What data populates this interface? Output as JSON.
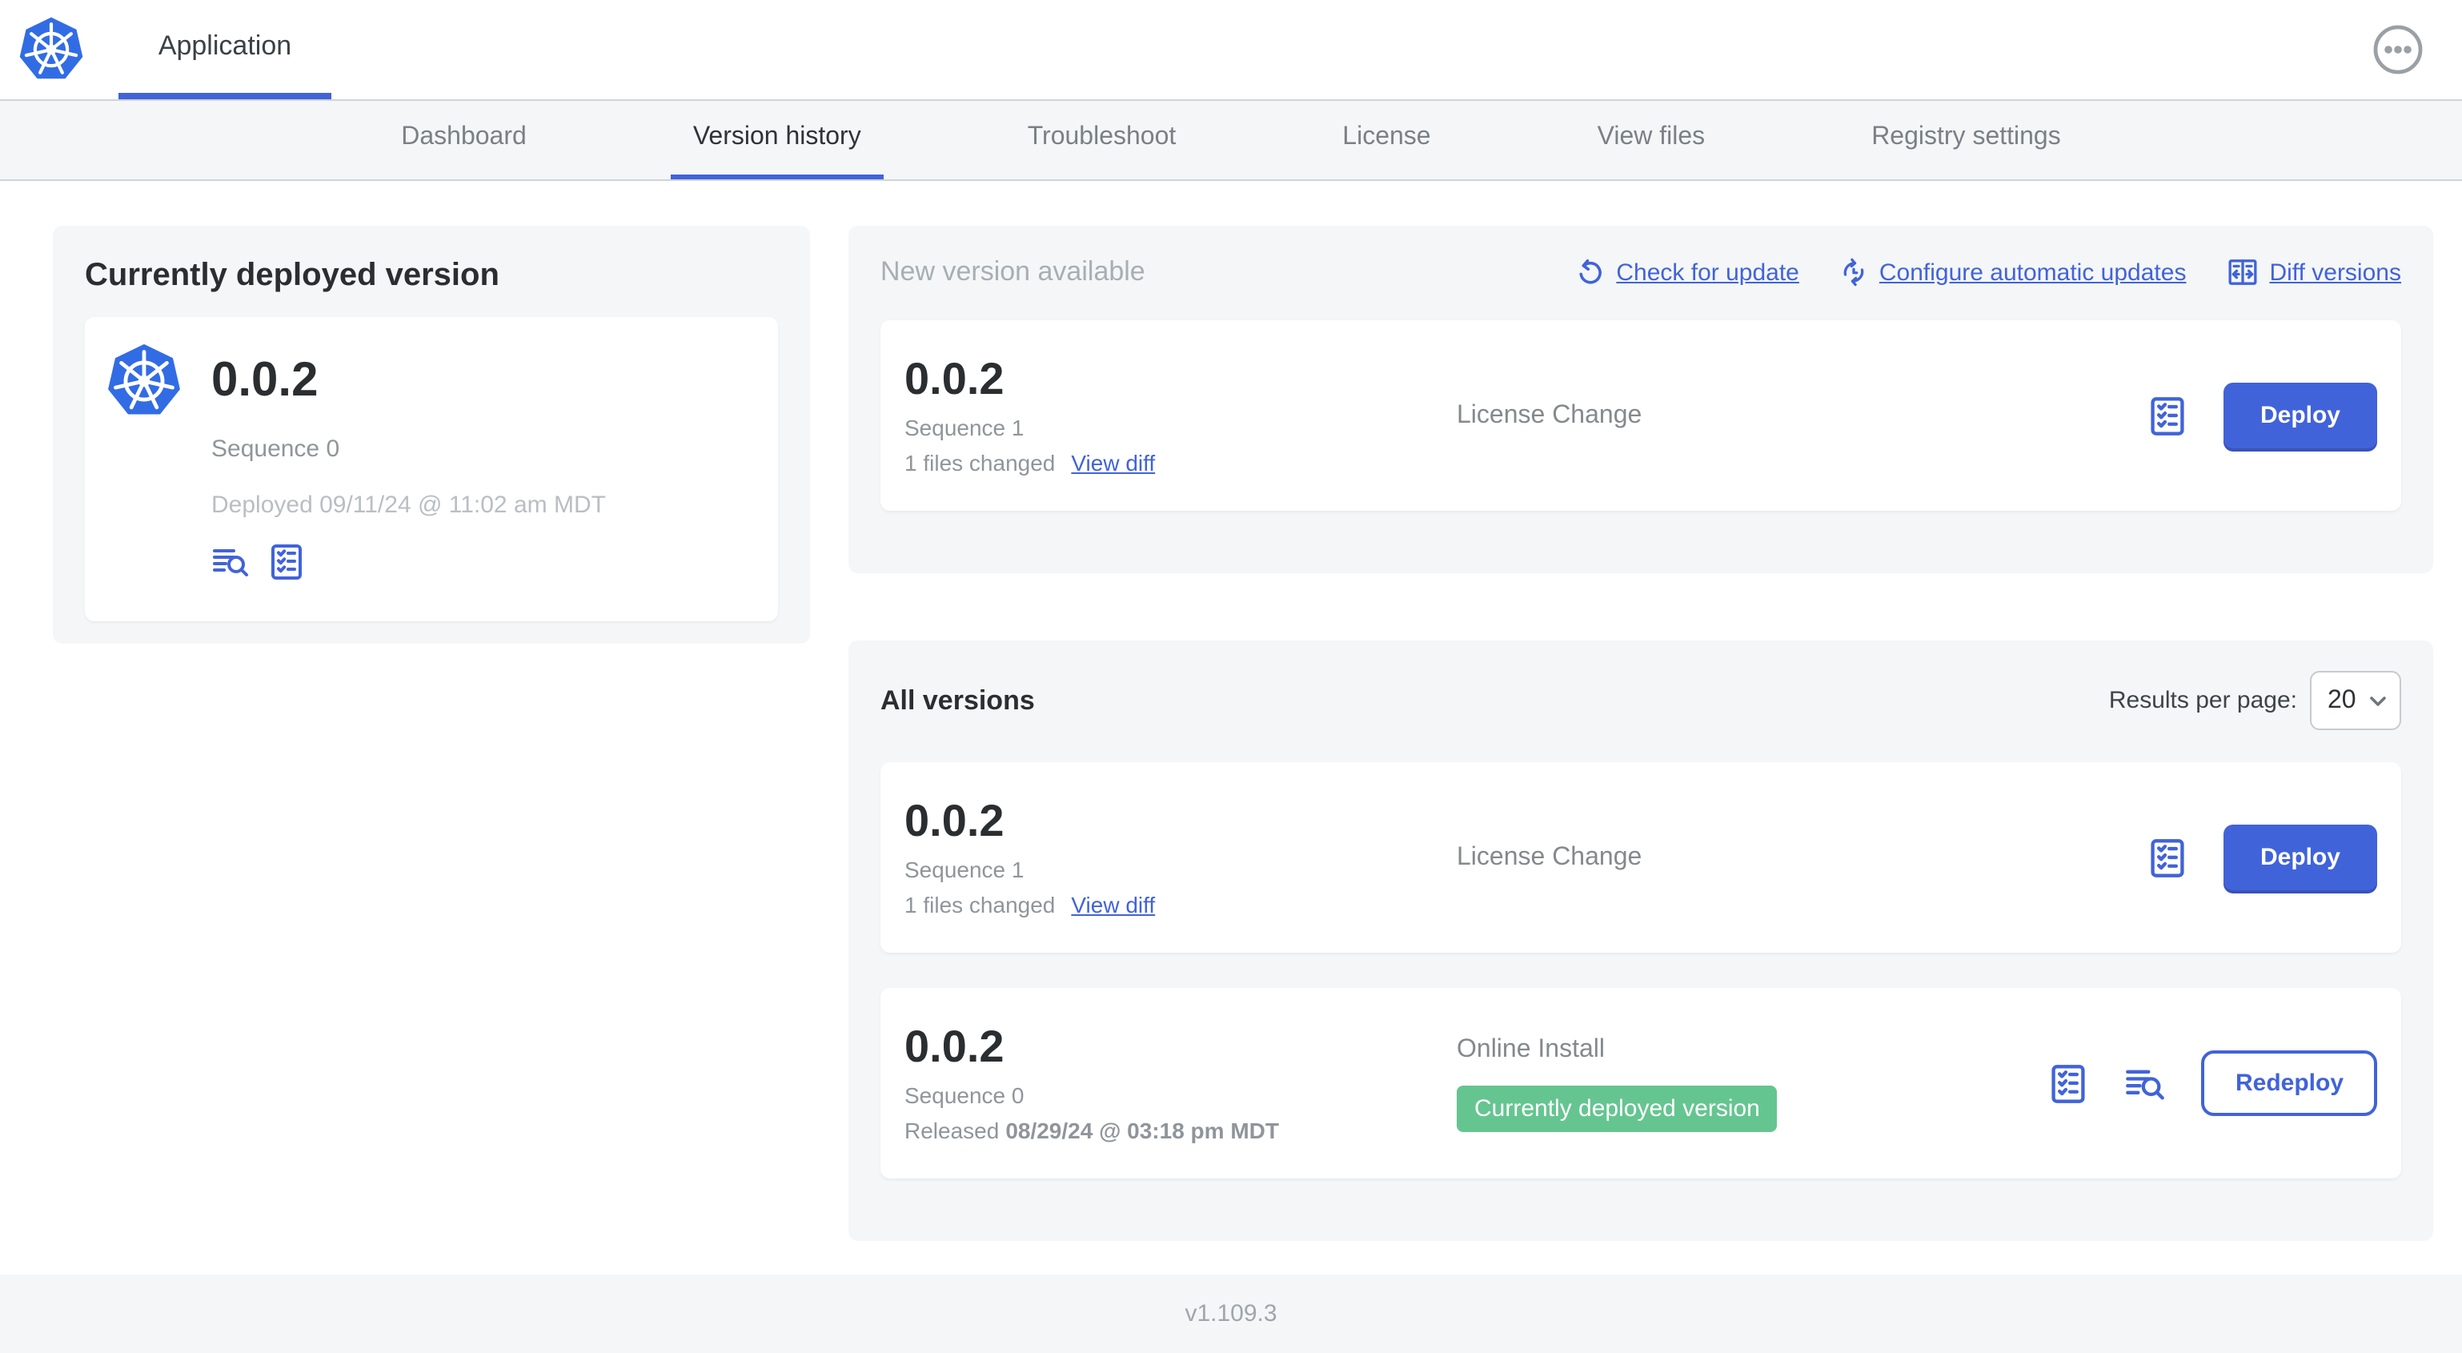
{
  "colors": {
    "accent": "#4163d9",
    "k8s_blue": "#326ce5",
    "green": "#65c590"
  },
  "header": {
    "app_tab": "Application"
  },
  "nav": {
    "tabs": [
      {
        "label": "Dashboard"
      },
      {
        "label": "Version history"
      },
      {
        "label": "Troubleshoot"
      },
      {
        "label": "License"
      },
      {
        "label": "View files"
      },
      {
        "label": "Registry settings"
      }
    ]
  },
  "current_version_card": {
    "title": "Currently deployed version",
    "version": "0.0.2",
    "sequence": "Sequence 0",
    "deployed": "Deployed 09/11/24 @ 11:02 am MDT"
  },
  "new_version_panel": {
    "title": "New version available",
    "links": {
      "check": "Check for update",
      "configure": "Configure automatic updates",
      "diff": "Diff versions"
    },
    "row": {
      "version": "0.0.2",
      "sequence": "Sequence 1",
      "files_changed": "1 files changed",
      "view_diff": "View diff",
      "label": "License Change",
      "deploy": "Deploy"
    }
  },
  "all_versions_panel": {
    "title": "All versions",
    "results_per_page_label": "Results per page:",
    "results_per_page_value": "20",
    "rows": [
      {
        "version": "0.0.2",
        "sequence": "Sequence 1",
        "files_changed": "1 files changed",
        "view_diff": "View diff",
        "label": "License Change",
        "action": "Deploy"
      },
      {
        "version": "0.0.2",
        "sequence": "Sequence 0",
        "released_prefix": "Released",
        "released_date": "08/29/24 @ 03:18 pm MDT",
        "label": "Online Install",
        "badge": "Currently deployed version",
        "action": "Redeploy"
      }
    ]
  },
  "footer": {
    "version": "v1.109.3"
  }
}
